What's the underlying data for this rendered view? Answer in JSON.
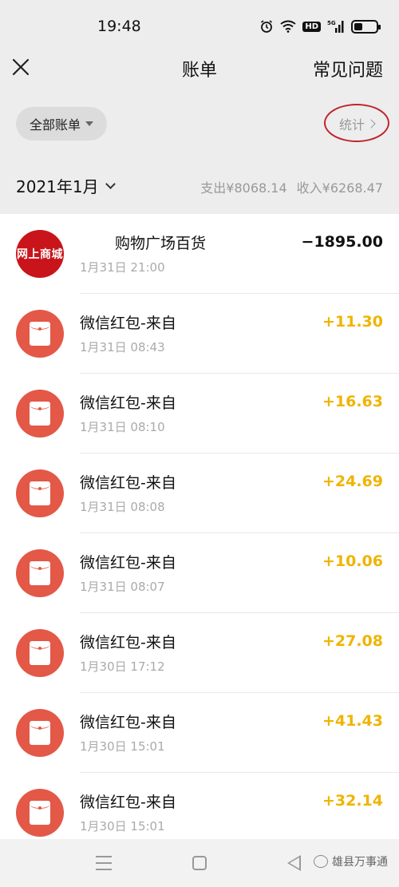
{
  "status_bar": {
    "time": "19:48",
    "hd": "HD",
    "signal": "5G"
  },
  "nav": {
    "title": "账单",
    "right_label": "常见问题"
  },
  "filter": {
    "label": "全部账单",
    "stats_label": "统计"
  },
  "month": {
    "label": "2021年1月",
    "expense": "支出¥8068.14",
    "income": "收入¥6268.47"
  },
  "transactions": [
    {
      "title": "购物广场百货",
      "time": "1月31日 21:00",
      "amount": "−1895.00",
      "type": "shop",
      "avatar_text": "网上商城"
    },
    {
      "title": "微信红包-来自",
      "time": "1月31日 08:43",
      "amount": "+11.30",
      "type": "red-packet"
    },
    {
      "title": "微信红包-来自",
      "time": "1月31日 08:10",
      "amount": "+16.63",
      "type": "red-packet"
    },
    {
      "title": "微信红包-来自",
      "time": "1月31日 08:08",
      "amount": "+24.69",
      "type": "red-packet"
    },
    {
      "title": "微信红包-来自",
      "time": "1月31日 08:07",
      "amount": "+10.06",
      "type": "red-packet"
    },
    {
      "title": "微信红包-来自",
      "time": "1月30日 17:12",
      "amount": "+27.08",
      "type": "red-packet"
    },
    {
      "title": "微信红包-来自",
      "time": "1月30日 15:01",
      "amount": "+41.43",
      "type": "red-packet"
    },
    {
      "title": "微信红包-来自",
      "time": "1月30日 15:01",
      "amount": "+32.14",
      "type": "red-packet"
    }
  ],
  "watermark": "雄县万事通",
  "colors": {
    "positive_amount": "#f0b400",
    "red_packet_icon": "#e35847",
    "annotation_circle": "#c0242b"
  },
  "icons": {
    "close": "close-icon",
    "menu": "menu-icon",
    "home": "home-icon",
    "back": "back-icon"
  }
}
